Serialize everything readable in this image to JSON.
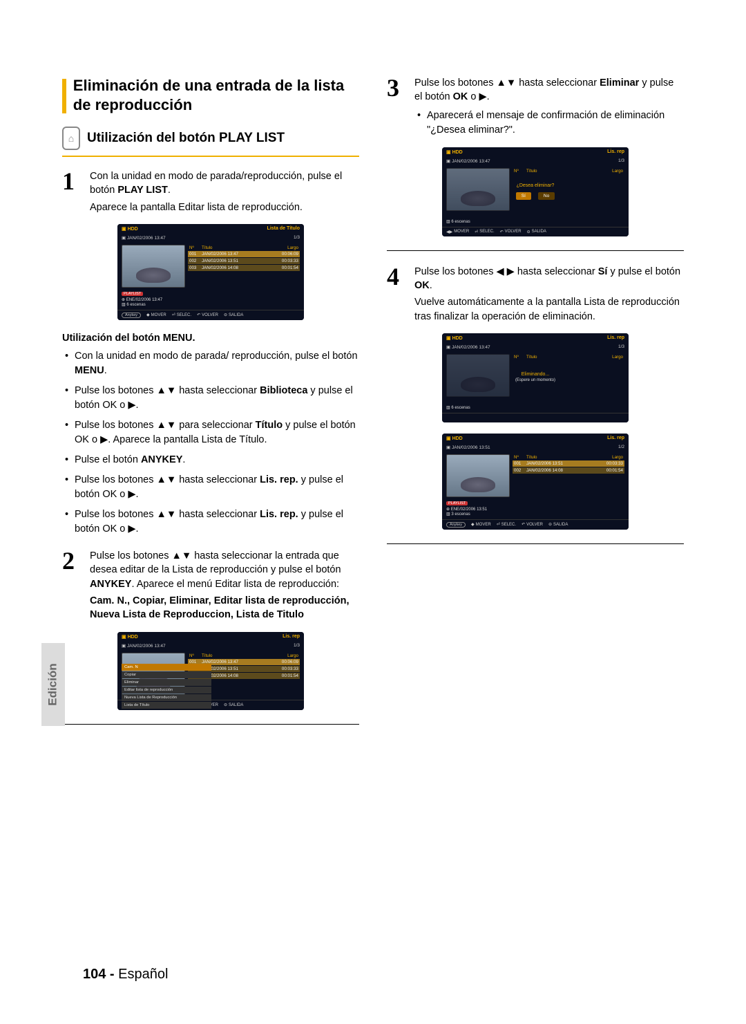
{
  "section_title": "Eliminación de una entrada de la lista de reproducción",
  "subsection_title": "Utilización del botón PLAY LIST",
  "side_tab": "Edición",
  "page_footer_num": "104 -",
  "page_footer_lang": "Español",
  "step1": {
    "line1": "Con la unidad en modo de parada/reproducción, pulse el botón ",
    "bold1": "PLAY LIST",
    "line2": "Aparece la pantalla Editar lista de reproducción."
  },
  "screen1": {
    "hdd": "HDD",
    "title": "Lista de Título",
    "date": "JAN/02/2006 13:47",
    "count": "1/3",
    "cols": {
      "c1": "Nº",
      "c2": "Título",
      "c3": "Largo"
    },
    "rows": [
      {
        "n": "001",
        "t": "JAN/02/2006 13:47",
        "d": "00:06:09"
      },
      {
        "n": "002",
        "t": "JAN/02/2006 13:51",
        "d": "00:03:33"
      },
      {
        "n": "003",
        "t": "JAN/02/2006 14:08",
        "d": "00:01:54"
      }
    ],
    "tag": "PLAYLIST",
    "meta1": "ENE/02/2006 13:47",
    "meta2": "6 escenas"
  },
  "footer_keys": {
    "anykey": "Anykey",
    "mover": "MOVER",
    "selec": "SELEC.",
    "volver": "VOLVER",
    "salida": "SALIDA"
  },
  "menu_section_title": "Utilización del botón MENU.",
  "bullets": [
    {
      "pre": "Con la unidad en modo de parada/ reproducción, pulse el botón ",
      "b": "MENU",
      "suf": "."
    },
    {
      "pre": "Pulse los botones ▲▼ hasta seleccionar ",
      "b": "Biblioteca",
      "suf": " y pulse el botón OK o ▶."
    },
    {
      "pre": "Pulse los botones ▲▼ para seleccionar ",
      "b": "Título",
      "suf": " y pulse el botón OK o ▶. Aparece la pantalla Lista de Título."
    },
    {
      "pre": "Pulse el botón ",
      "b": "ANYKEY",
      "suf": "."
    },
    {
      "pre": "Pulse los botones ▲▼ hasta seleccionar ",
      "b": "Lis. rep.",
      "suf": " y pulse el botón OK o ▶."
    },
    {
      "pre": "Pulse los botones ▲▼ hasta seleccionar ",
      "b": "Lis. rep.",
      "suf": " y pulse el botón OK o ▶."
    }
  ],
  "step2": {
    "t1": "Pulse los botones ▲▼ hasta seleccionar la entrada que desea editar de la Lista de reproducción y pulse el botón ",
    "b1": "ANYKEY",
    "t2": ". Aparece el menú Editar lista de reproducción: ",
    "b2": "Cam. N., Copiar, Eliminar, Editar lista de reproducción, Nueva Lista de Reproduccion, Lista de Titulo"
  },
  "screen2": {
    "hdd": "HDD",
    "title": "Lis. rep",
    "date": "JAN/02/2006 13:47",
    "count": "1/3",
    "cols": {
      "c1": "Nº",
      "c2": "Título",
      "c3": "Largo"
    },
    "rows": [
      {
        "n": "001",
        "t": "JAN/02/2006 13:47",
        "d": "00:06:09"
      },
      {
        "n": "",
        "t": "JAN/02/2006 13:51",
        "d": "00:03:33"
      },
      {
        "n": "",
        "t": "JAN/02/2006 14:08",
        "d": "00:01:54"
      }
    ],
    "menu": [
      "Cam. N",
      "Copiar",
      "Eliminar",
      "Editar lista de reproducción",
      "Nueva Lista de Reproducción",
      "Lista de Título"
    ]
  },
  "step3": {
    "t1": "Pulse los botones ▲▼ hasta seleccionar ",
    "b1": "Eliminar",
    "t2": " y pulse el botón ",
    "b2": "OK",
    "t3": " o ▶.",
    "li": "Aparecerá el mensaje de confirmación de eliminación \"¿Desea eliminar?\"."
  },
  "screen3": {
    "hdd": "HDD",
    "title": "Lis. rep",
    "date": "JAN/02/2006 13:47",
    "count": "1/3",
    "cols": {
      "c1": "Nº",
      "c2": "Título",
      "c3": "Largo"
    },
    "msg": "¿Desea eliminar?",
    "yes": "Sí",
    "no": "No",
    "meta": "6 escenas"
  },
  "step4": {
    "t1": "Pulse los botones ◀ ▶ hasta seleccionar ",
    "b1": "Sí",
    "t2": " y pulse el botón ",
    "b2": "OK",
    "t3": ".",
    "t4": "Vuelve automáticamente a la pantalla Lista de reproducción tras finalizar la operación de eliminación."
  },
  "screen4": {
    "hdd": "HDD",
    "title": "Lis. rep",
    "date": "JAN/02/2006 13:47",
    "count": "1/3",
    "cols": {
      "c1": "Nº",
      "c2": "Título",
      "c3": "Largo"
    },
    "msg": "Eliminando...",
    "sub": "(Espere un momento)",
    "meta": "6 escenas"
  },
  "screen5": {
    "hdd": "HDD",
    "title": "Lis. rep",
    "date": "JAN/02/2006 13:51",
    "count": "1/2",
    "cols": {
      "c1": "Nº",
      "c2": "Título",
      "c3": "Largo"
    },
    "rows": [
      {
        "n": "001",
        "t": "JAN/02/2006 13:51",
        "d": "00:03:33"
      },
      {
        "n": "002",
        "t": "JAN/02/2006 14:08",
        "d": "00:01:54"
      }
    ],
    "tag": "PLAYLIST",
    "meta1": "ENE/02/2006 13:51",
    "meta2": "3 escenas"
  }
}
